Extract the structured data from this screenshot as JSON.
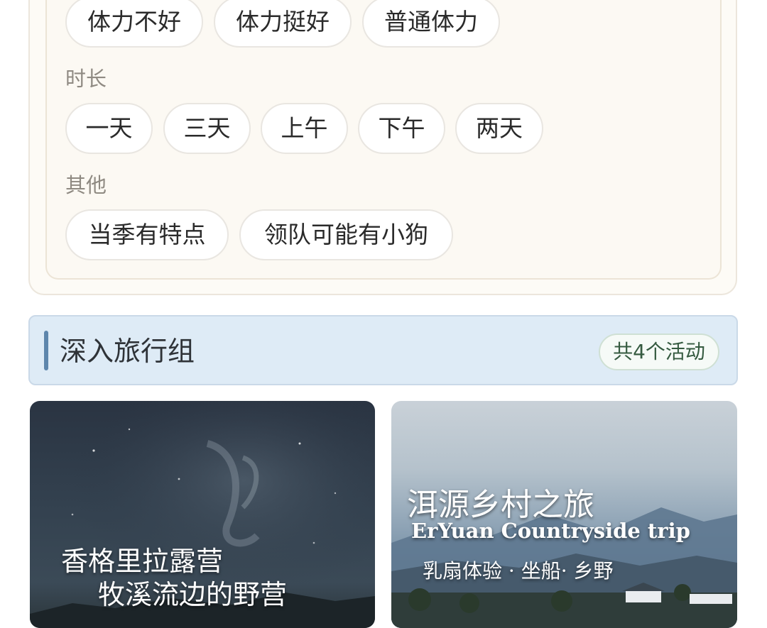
{
  "filters": {
    "stamina": {
      "options": [
        "体力不好",
        "体力挺好",
        "普通体力"
      ]
    },
    "duration": {
      "label": "时长",
      "options": [
        "一天",
        "三天",
        "上午",
        "下午",
        "两天"
      ]
    },
    "other": {
      "label": "其他",
      "options": [
        "当季有特点",
        "领队可能有小狗"
      ]
    }
  },
  "section": {
    "title": "深入旅行组",
    "count": "共4个活动",
    "accent_color": "#5e86ac",
    "background_color": "#deebf6"
  },
  "cards": [
    {
      "title_line_1": "香格里拉露营",
      "title_line_2": "牧溪流边的野营"
    },
    {
      "title_cn": "洱源乡村之旅",
      "title_en": "ErYuan Countryside trip",
      "subtitle": "乳扇体验 · 坐船· 乡野"
    }
  ]
}
